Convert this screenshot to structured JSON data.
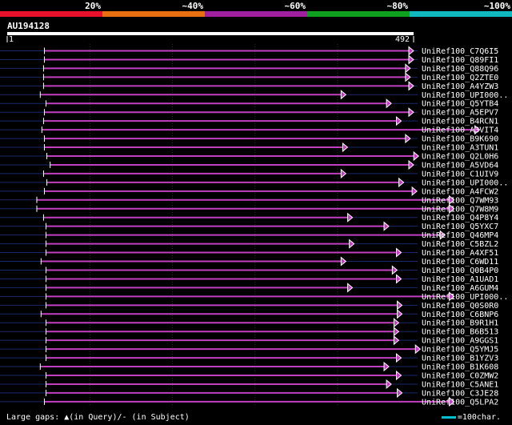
{
  "header": {
    "labels": [
      "20%",
      "~40%",
      "~60%",
      "~80%",
      "~100%"
    ],
    "colors": [
      "#e8102a",
      "#e87010",
      "#a020a0",
      "#10a020",
      "#10b8c0"
    ]
  },
  "query": {
    "name": "AU194128",
    "start": "1",
    "end": "492",
    "length": 492
  },
  "hits": [
    {
      "name": "UniRef100_C7Q6I5",
      "start": 45,
      "end": 492,
      "color": "#c040c0"
    },
    {
      "name": "UniRef100_Q89FI1",
      "start": 45,
      "end": 492,
      "color": "#c040c0"
    },
    {
      "name": "UniRef100_Q88Q96",
      "start": 44,
      "end": 488,
      "color": "#c040c0"
    },
    {
      "name": "UniRef100_Q2ZTE0",
      "start": 44,
      "end": 488,
      "color": "#c040c0"
    },
    {
      "name": "UniRef100_A4YZW3",
      "start": 44,
      "end": 492,
      "color": "#c040c0"
    },
    {
      "name": "UniRef100_UPI000..",
      "start": 40,
      "end": 410,
      "color": "#c040c0"
    },
    {
      "name": "UniRef100_Q5YTB4",
      "start": 47,
      "end": 465,
      "color": "#c040c0"
    },
    {
      "name": "UniRef100_A5EPV7",
      "start": 45,
      "end": 492,
      "color": "#c040c0"
    },
    {
      "name": "UniRef100_B4RCN1",
      "start": 44,
      "end": 477,
      "color": "#c040c0"
    },
    {
      "name": "UniRef100_A3VIT4",
      "start": 42,
      "end": 572,
      "color": "#c040c0"
    },
    {
      "name": "UniRef100_B9K690",
      "start": 45,
      "end": 488,
      "color": "#c040c0"
    },
    {
      "name": "UniRef100_A3TUN1",
      "start": 45,
      "end": 412,
      "color": "#c040c0"
    },
    {
      "name": "UniRef100_Q2L0H6",
      "start": 48,
      "end": 498,
      "color": "#c040c0"
    },
    {
      "name": "UniRef100_A5VD64",
      "start": 52,
      "end": 492,
      "color": "#c040c0"
    },
    {
      "name": "UniRef100_C1UIV9",
      "start": 44,
      "end": 410,
      "color": "#c040c0"
    },
    {
      "name": "UniRef100_UPI000..",
      "start": 48,
      "end": 480,
      "color": "#c040c0"
    },
    {
      "name": "UniRef100_A4FCW2",
      "start": 45,
      "end": 496,
      "color": "#c040c0"
    },
    {
      "name": "UniRef100_Q7WM93",
      "start": -2,
      "end": 541,
      "color": "#c040c0"
    },
    {
      "name": "UniRef100_Q7W8M9",
      "start": -2,
      "end": 541,
      "color": "#c040c0"
    },
    {
      "name": "UniRef100_Q4P8Y4",
      "start": 44,
      "end": 418,
      "color": "#c040c0"
    },
    {
      "name": "UniRef100_Q5YXC7",
      "start": 47,
      "end": 462,
      "color": "#c040c0"
    },
    {
      "name": "UniRef100_Q46MP4",
      "start": 47,
      "end": 530,
      "color": "#c040c0"
    },
    {
      "name": "UniRef100_C5BZL2",
      "start": 47,
      "end": 420,
      "color": "#c040c0"
    },
    {
      "name": "UniRef100_A4XF51",
      "start": 47,
      "end": 477,
      "color": "#c040c0"
    },
    {
      "name": "UniRef100_C6WD11",
      "start": 41,
      "end": 410,
      "color": "#c040c0"
    },
    {
      "name": "UniRef100_Q0B4P0",
      "start": 47,
      "end": 472,
      "color": "#c040c0"
    },
    {
      "name": "UniRef100_A1UAD1",
      "start": 47,
      "end": 477,
      "color": "#c040c0"
    },
    {
      "name": "UniRef100_A6GUM4",
      "start": 47,
      "end": 418,
      "color": "#c040c0"
    },
    {
      "name": "UniRef100_UPI000..",
      "start": 47,
      "end": 541,
      "color": "#c040c0"
    },
    {
      "name": "UniRef100_Q0S0R0",
      "start": 47,
      "end": 478,
      "color": "#c040c0"
    },
    {
      "name": "UniRef100_C6BNP6",
      "start": 41,
      "end": 478,
      "color": "#c040c0"
    },
    {
      "name": "UniRef100_B9R1H1",
      "start": 47,
      "end": 474,
      "color": "#c040c0"
    },
    {
      "name": "UniRef100_B6B513",
      "start": 47,
      "end": 474,
      "color": "#c040c0"
    },
    {
      "name": "UniRef100_A9GGS1",
      "start": 47,
      "end": 474,
      "color": "#c040c0"
    },
    {
      "name": "UniRef100_Q5YMJ5",
      "start": 47,
      "end": 500,
      "color": "#c040c0"
    },
    {
      "name": "UniRef100_B1YZV3",
      "start": 47,
      "end": 477,
      "color": "#c040c0"
    },
    {
      "name": "UniRef100_B1K608",
      "start": 40,
      "end": 462,
      "color": "#c040c0"
    },
    {
      "name": "UniRef100_C0ZMW2",
      "start": 47,
      "end": 477,
      "color": "#c040c0"
    },
    {
      "name": "UniRef100_C5ANE1",
      "start": 47,
      "end": 465,
      "color": "#c040c0"
    },
    {
      "name": "UniRef100_C3JE28",
      "start": 47,
      "end": 478,
      "color": "#c040c0"
    },
    {
      "name": "UniRef100_Q5LPA2",
      "start": 45,
      "end": 541,
      "color": "#c040c0"
    }
  ],
  "footer": {
    "text": "Large gaps: ▲(in Query)/- (in Subject)",
    "legend": "=100char."
  },
  "line_color": "#18286a"
}
